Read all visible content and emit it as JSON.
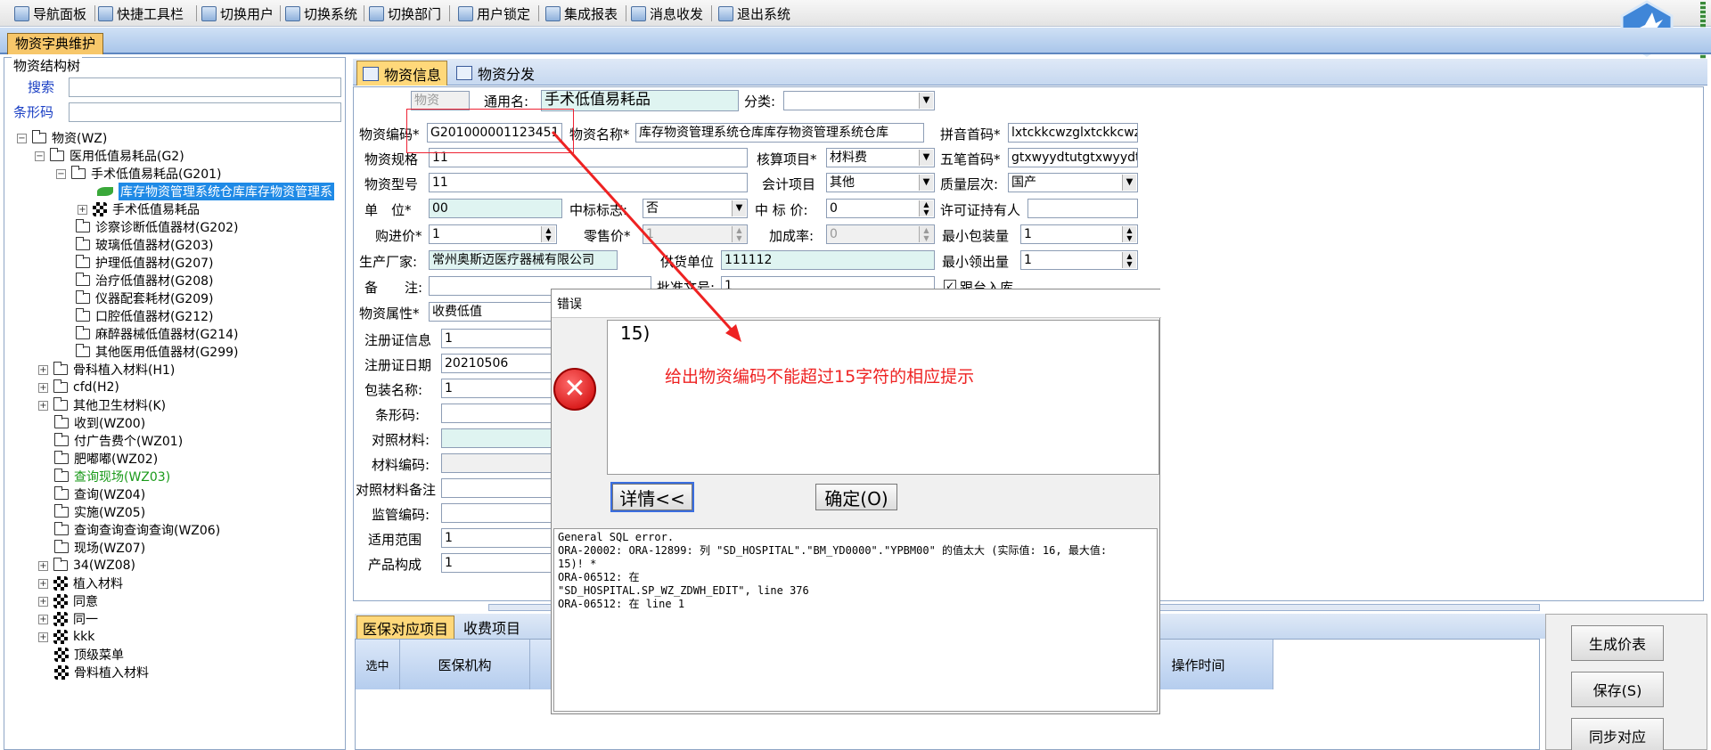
{
  "menubar": {
    "items": [
      "导航面板",
      "快捷工具栏",
      "切换用户",
      "切换系统",
      "切换部门",
      "用户锁定",
      "集成报表",
      "消息收发",
      "退出系统"
    ]
  },
  "tabs": {
    "main": "物资字典维护"
  },
  "left": {
    "title": "物资结构树",
    "search_label": "搜索",
    "barcode_label": "条形码",
    "tree": [
      "物资(WZ)",
      "医用低值易耗品(G2)",
      "手术低值易耗品(G201)",
      "库存物资管理系统仓库库存物资管理系",
      "手术低值易耗品",
      "诊察诊断低值器材(G202)",
      "玻璃低值器材(G203)",
      "护理低值器材(G207)",
      "治疗低值器材(G208)",
      "仪器配套耗材(G209)",
      "口腔低值器材(G212)",
      "麻醉器械低值器材(G214)",
      "其他医用低值器材(G299)",
      "骨科植入材料(H1)",
      "cfd(H2)",
      "其他卫生材料(K)",
      "收到(WZ00)",
      "付广告费个(WZ01)",
      "肥嘟嘟(WZ02)",
      "查询现场(WZ03)",
      "查询(WZ04)",
      "实施(WZ05)",
      "查询查询查询查询(WZ06)",
      "现场(WZ07)",
      "34(WZ08)",
      "植入材料",
      "同意",
      "同一",
      "kkk",
      "顶级菜单",
      "骨料植入材料"
    ]
  },
  "subtabs": [
    "物资信息",
    "物资分发"
  ],
  "form": {
    "wz_tag": "物资",
    "tym_label": "通用名:",
    "tym_value": "手术低值易耗品",
    "fl_label": "分类:",
    "bm_label": "物资编码*",
    "bm_value": "G201000001123451",
    "mc_label": "物资名称*",
    "mc_value": "库存物资管理系统仓库库存物资管理系统仓库",
    "py_label": "拼音首码*",
    "py_value": "lxtckkcwzglxtckkcwzglxtck",
    "gg_label": "物资规格",
    "gg_value": "11",
    "hs_label": "核算项目*",
    "hs_value": "材料费",
    "wb_label": "五笔首码*",
    "wb_value": "gtxwyydtutgtxwyydtutg",
    "xh_label": "物资型号",
    "xh_value": "11",
    "kj_label": "会计项目",
    "kj_value": "其他",
    "zl_label": "质量层次:",
    "zl_value": "国产",
    "dw_label": "单　位*",
    "dw_value": "00",
    "zb_label": "中标标志:",
    "zb_value": "否",
    "zbj_label": "中 标 价:",
    "zbj_value": "0",
    "xk_label": "许可证持有人",
    "gj_label": "购进价*",
    "gj_value": "1",
    "ls_label": "零售价*",
    "ls_value": "1",
    "jc_label": "加成率:",
    "jc_value": "0",
    "bz_label": "最小包装量",
    "bz_value": "1",
    "cj_label": "生产厂家:",
    "cj_value": "常州奥斯迈医疗器械有限公司",
    "gh_label": "供货单位",
    "gh_value": "111112",
    "lc_label": "最小领出量",
    "lc_value": "1",
    "beizhu_label": "备　　注:",
    "pz_label": "批准文号:",
    "pz_value": "1",
    "gt_label": "跟台入库",
    "sx_label": "物资属性*",
    "sx_value": "收费低值",
    "zc_label": "注册证信息",
    "zc_value": "1",
    "zcrq_label": "注册证日期",
    "zcrq_value": "20210506",
    "bzmc_label": "包装名称:",
    "bzmc_value": "1",
    "txm_label": "条形码:",
    "dzcl_label": "对照材料:",
    "clbm_label": "材料编码:",
    "dzbz_label": "对照材料备注",
    "jgbm_label": "监管编码:",
    "syfw_label": "适用范围",
    "syfw_value": "1",
    "cpgc_label": "产品构成",
    "cpgc_value": "1"
  },
  "bottom": {
    "tabs": [
      "医保对应项目",
      "收费项目"
    ],
    "cols": [
      "选中",
      "医保机构",
      "操作时间"
    ]
  },
  "right_buttons": [
    "生成价表",
    "保存(S)",
    "同步对应"
  ],
  "dialog": {
    "title": "错误",
    "message": "15)",
    "annotation": "给出物资编码不能超过15字符的相应提示",
    "details_button": "详情<<",
    "ok_button": "确定(O)",
    "details": "General SQL error.\nORA-20002: ORA-12899: 列 \"SD_HOSPITAL\".\"BM_YD0000\".\"YPBM00\" 的值太大 (实际值: 16, 最大值:\n15)! *\nORA-06512: 在\n\"SD_HOSPITAL.SP_WZ_ZDWH_EDIT\", line 376\nORA-06512: 在 line 1"
  },
  "colors": {
    "accent": "#1f8ae6",
    "error": "#e22222",
    "tab": "#ffd87a"
  }
}
